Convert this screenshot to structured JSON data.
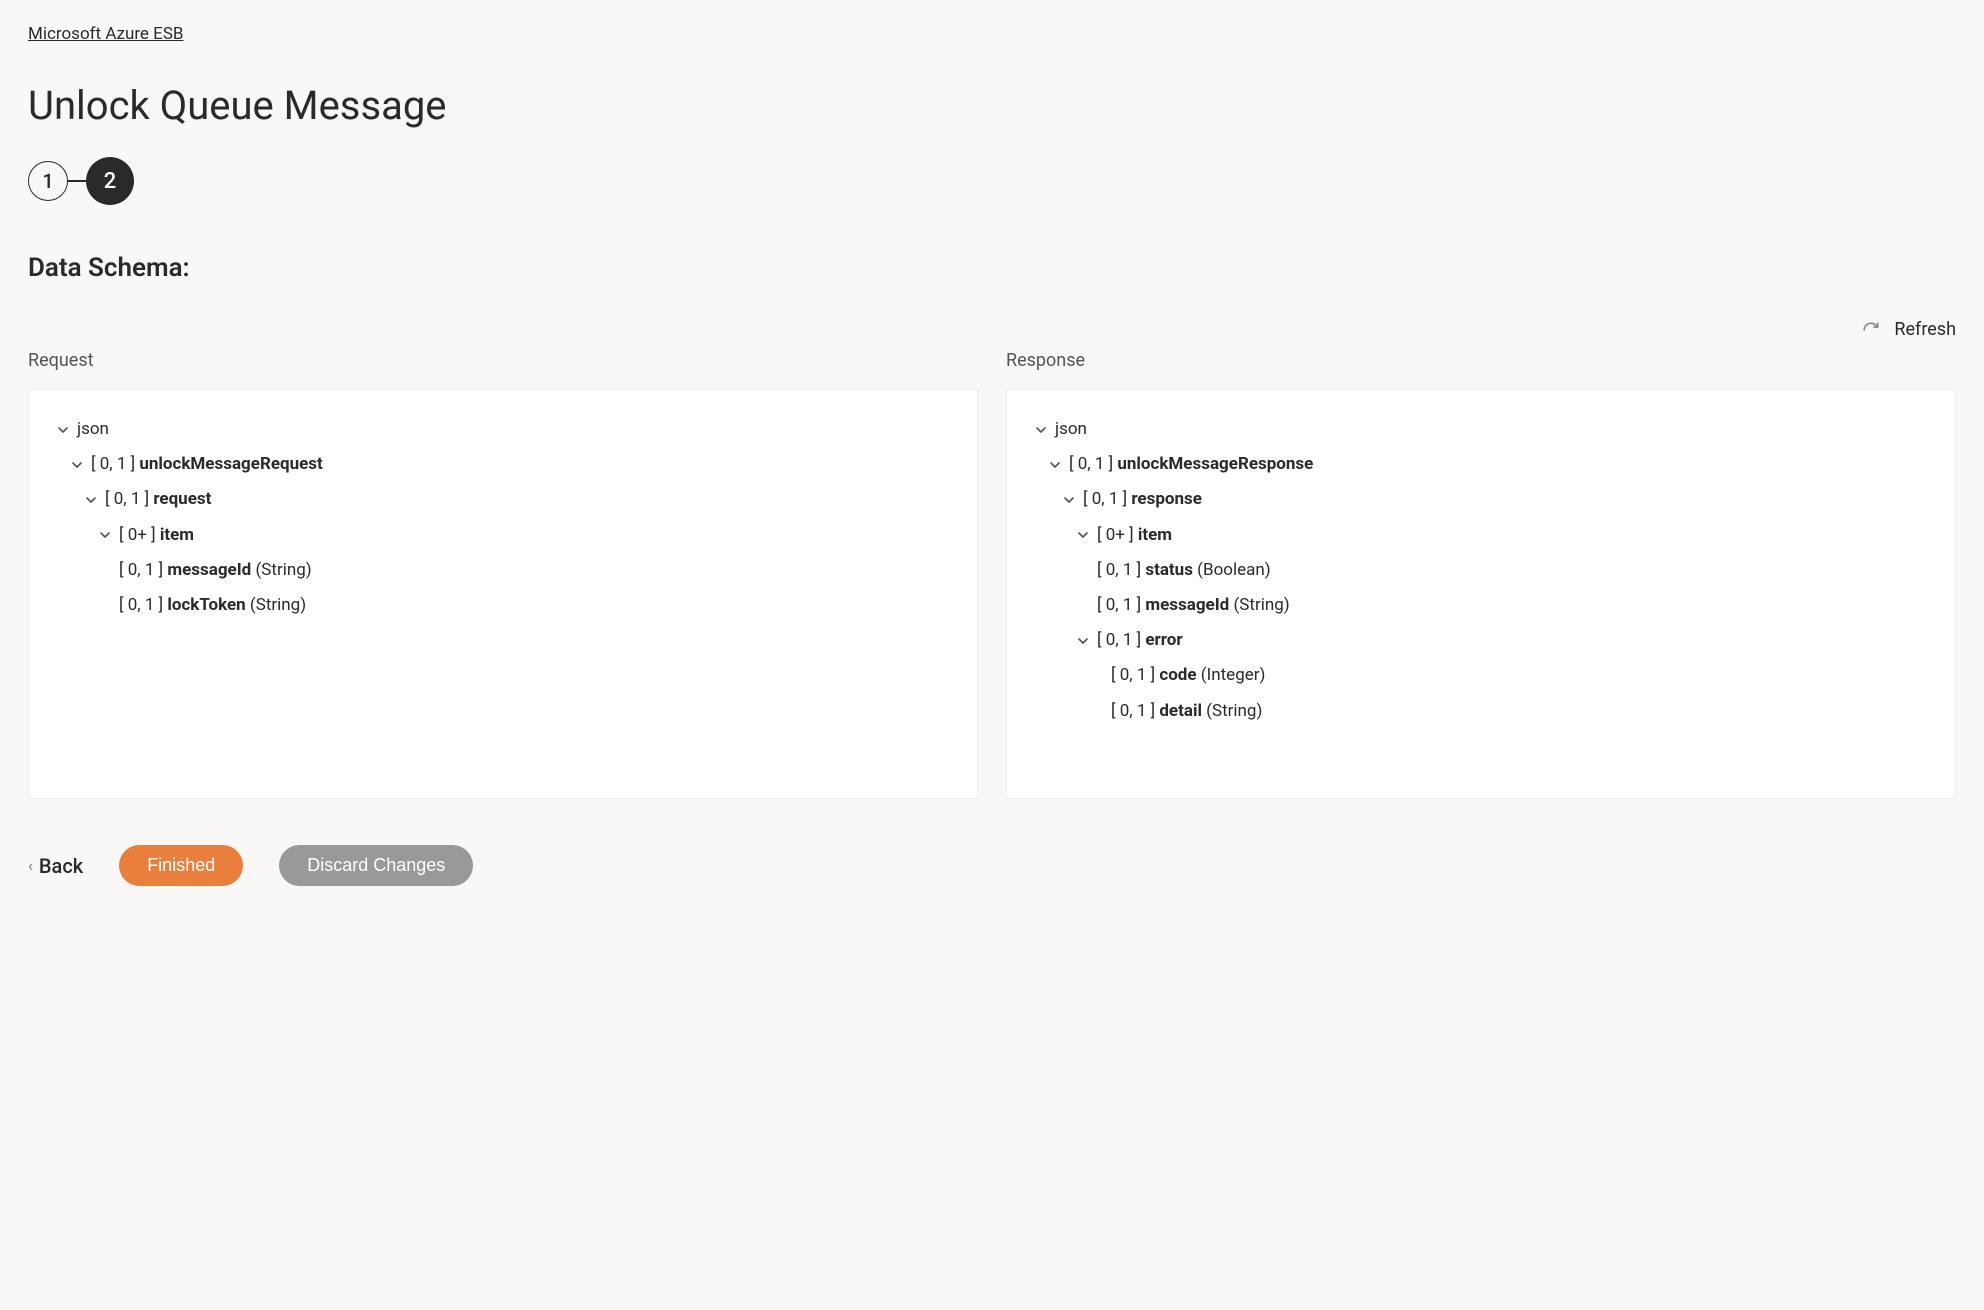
{
  "breadcrumb": "Microsoft Azure ESB",
  "page_title": "Unlock Queue Message",
  "stepper": {
    "step1": "1",
    "step2": "2"
  },
  "section_heading": "Data Schema:",
  "refresh_label": "Refresh",
  "request_label": "Request",
  "response_label": "Response",
  "request_tree": {
    "root": "json",
    "n1": {
      "card": "[ 0, 1 ]",
      "name": "unlockMessageRequest"
    },
    "n2": {
      "card": "[ 0, 1 ]",
      "name": "request"
    },
    "n3": {
      "card": "[ 0+ ]",
      "name": "item"
    },
    "n4": {
      "card": "[ 0, 1 ]",
      "name": "messageId",
      "type": "(String)"
    },
    "n5": {
      "card": "[ 0, 1 ]",
      "name": "lockToken",
      "type": "(String)"
    }
  },
  "response_tree": {
    "root": "json",
    "n1": {
      "card": "[ 0, 1 ]",
      "name": "unlockMessageResponse"
    },
    "n2": {
      "card": "[ 0, 1 ]",
      "name": "response"
    },
    "n3": {
      "card": "[ 0+ ]",
      "name": "item"
    },
    "n4": {
      "card": "[ 0, 1 ]",
      "name": "status",
      "type": "(Boolean)"
    },
    "n5": {
      "card": "[ 0, 1 ]",
      "name": "messageId",
      "type": "(String)"
    },
    "n6": {
      "card": "[ 0, 1 ]",
      "name": "error"
    },
    "n7": {
      "card": "[ 0, 1 ]",
      "name": "code",
      "type": "(Integer)"
    },
    "n8": {
      "card": "[ 0, 1 ]",
      "name": "detail",
      "type": "(String)"
    }
  },
  "footer": {
    "back": "Back",
    "finished": "Finished",
    "discard": "Discard Changes"
  }
}
